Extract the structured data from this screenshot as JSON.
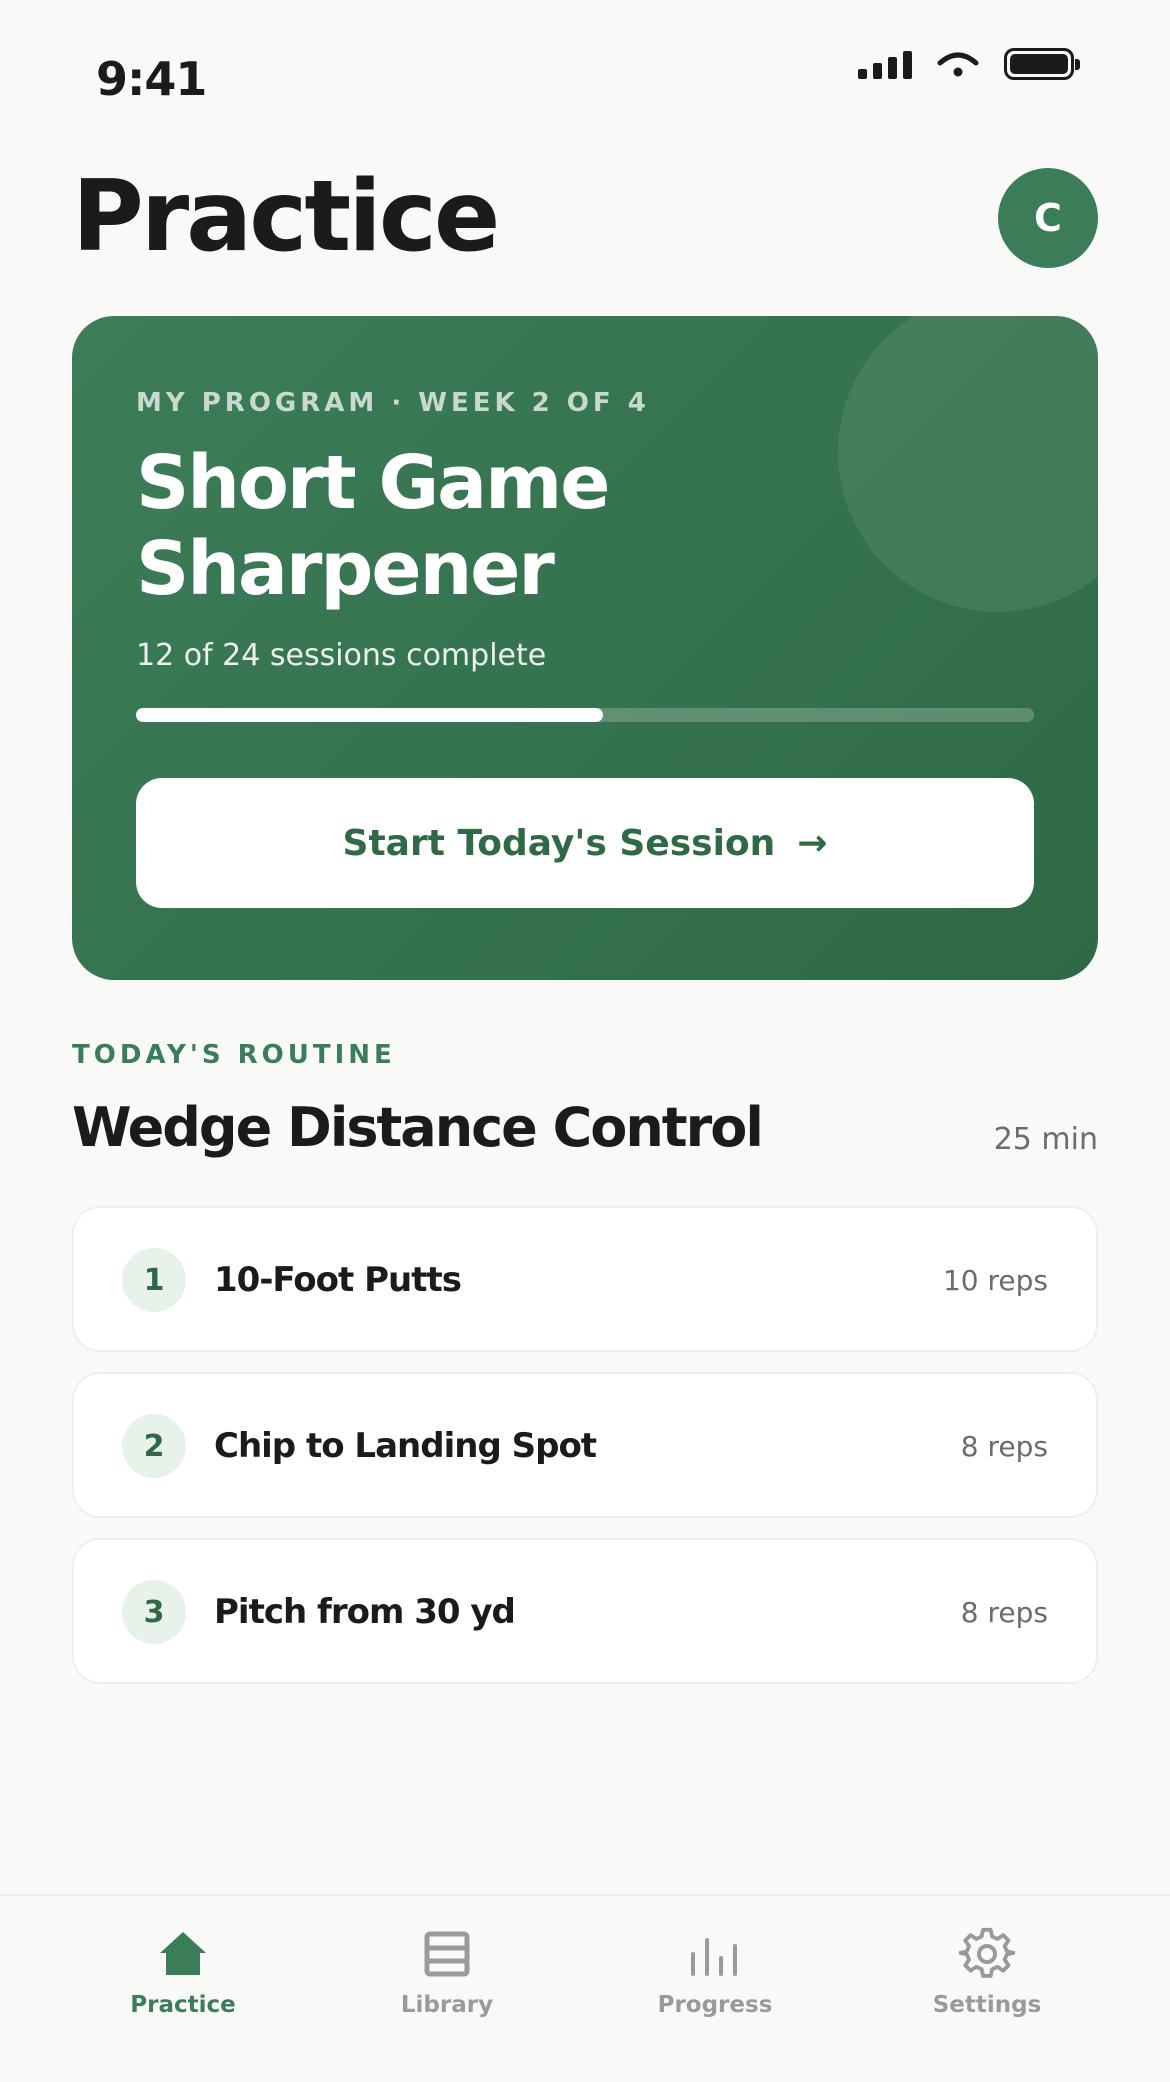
{
  "status_bar": {
    "time": "9:41"
  },
  "header": {
    "title": "Practice",
    "avatar_initial": "C"
  },
  "program": {
    "eyebrow": "MY PROGRAM · WEEK 2 OF 4",
    "title": "Short Game Sharpener",
    "subtitle": "12 of 24 sessions complete",
    "progress_fraction": 0.52,
    "button_label": "Start Today's Session",
    "button_arrow": "→"
  },
  "routine": {
    "eyebrow": "TODAY'S ROUTINE",
    "title": "Wedge Distance Control",
    "duration": "25 min",
    "drills": [
      {
        "number": "1",
        "name": "10-Foot Putts",
        "reps": "10 reps"
      },
      {
        "number": "2",
        "name": "Chip to Landing Spot",
        "reps": "8 reps"
      },
      {
        "number": "3",
        "name": "Pitch from 30 yd",
        "reps": "8 reps"
      }
    ]
  },
  "tabs": [
    {
      "label": "Practice",
      "icon": "home-icon",
      "active": true
    },
    {
      "label": "Library",
      "icon": "library-icon",
      "active": false
    },
    {
      "label": "Progress",
      "icon": "bar-chart-icon",
      "active": false
    },
    {
      "label": "Settings",
      "icon": "gear-icon",
      "active": false
    }
  ],
  "colors": {
    "accent": "#3a7d58",
    "card_dark": "#2f6946",
    "inactive": "#9a9a9a"
  }
}
